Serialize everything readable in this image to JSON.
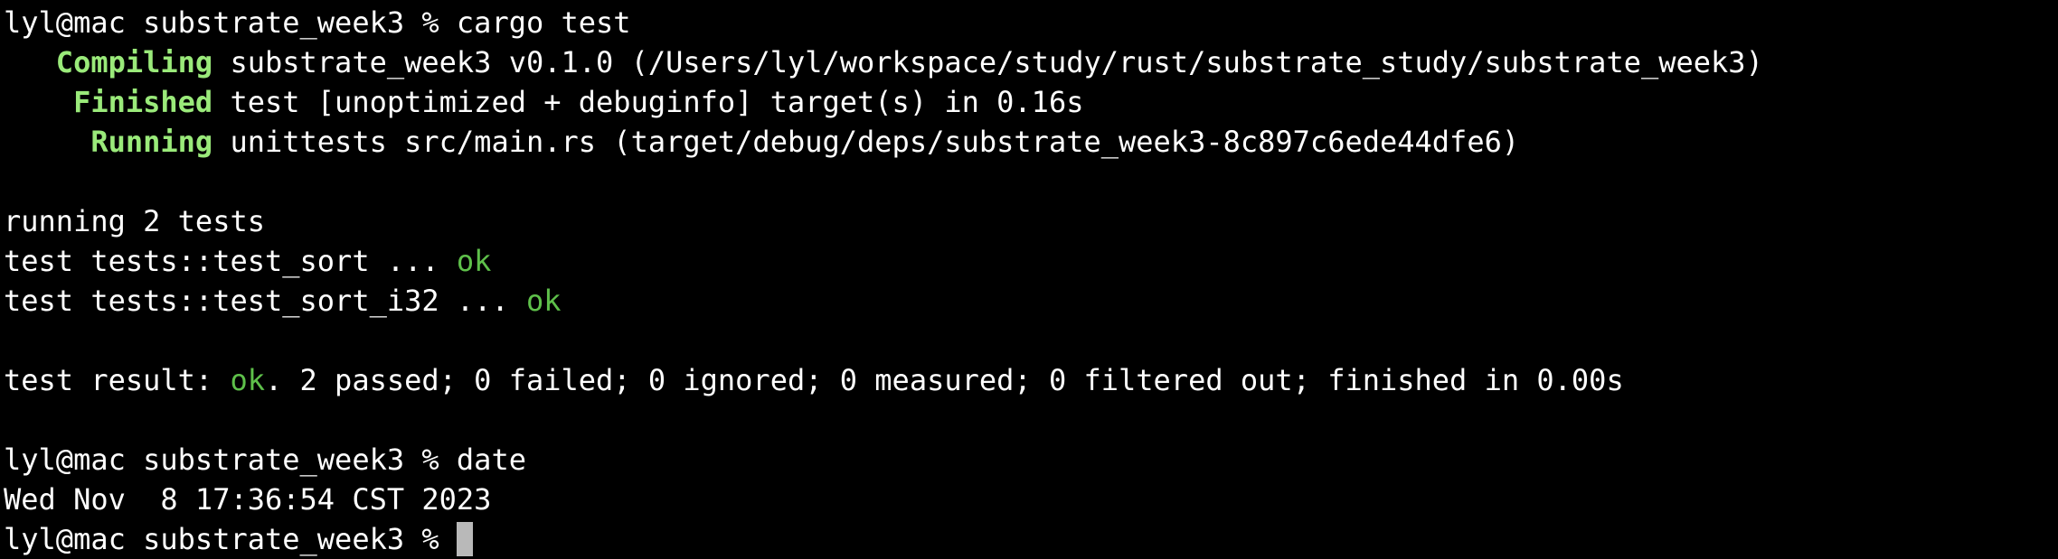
{
  "colors": {
    "background": "#000000",
    "text": "#ffffff",
    "status_keyword": "#9aea7a",
    "ok": "#5ec04a",
    "cursor": "#b9b9b9"
  },
  "session": [
    {
      "kind": "prompt",
      "prompt": "lyl@mac substrate_week3 % ",
      "command": "cargo test"
    },
    {
      "kind": "status",
      "pad": "   ",
      "keyword": "Compiling",
      "text": " substrate_week3 v0.1.0 (/Users/lyl/workspace/study/rust/substrate_study/substrate_week3)"
    },
    {
      "kind": "status",
      "pad": "    ",
      "keyword": "Finished",
      "text": " test [unoptimized + debuginfo] target(s) in 0.16s"
    },
    {
      "kind": "status",
      "pad": "     ",
      "keyword": "Running",
      "text": " unittests src/main.rs (target/debug/deps/substrate_week3-8c897c6ede44dfe6)"
    },
    {
      "kind": "blank"
    },
    {
      "kind": "plain",
      "text": "running 2 tests"
    },
    {
      "kind": "test",
      "text": "test tests::test_sort ... ",
      "result": "ok"
    },
    {
      "kind": "test",
      "text": "test tests::test_sort_i32 ... ",
      "result": "ok"
    },
    {
      "kind": "blank"
    },
    {
      "kind": "summary",
      "prefix": "test result: ",
      "result": "ok",
      "suffix": ". 2 passed; 0 failed; 0 ignored; 0 measured; 0 filtered out; finished in 0.00s"
    },
    {
      "kind": "blank"
    },
    {
      "kind": "prompt",
      "prompt": "lyl@mac substrate_week3 % ",
      "command": "date"
    },
    {
      "kind": "plain",
      "text": "Wed Nov  8 17:36:54 CST 2023"
    },
    {
      "kind": "prompt",
      "prompt": "lyl@mac substrate_week3 % ",
      "command": "",
      "cursor": true
    }
  ]
}
